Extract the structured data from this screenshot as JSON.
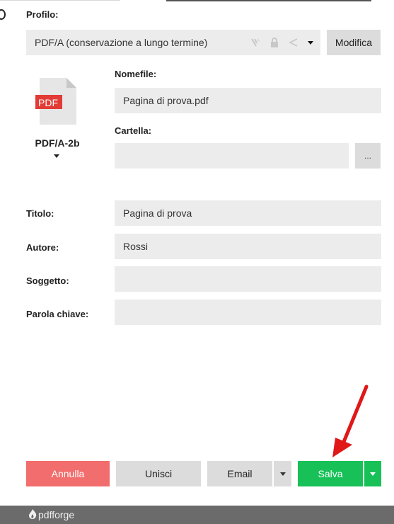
{
  "profile": {
    "label": "Profilo:",
    "value": "PDF/A (conservazione a lungo termine)",
    "edit_button": "Modifica",
    "icons": [
      "signature-icon",
      "lock-icon",
      "share-icon",
      "chevron-down-icon"
    ]
  },
  "document": {
    "icon_label": "PDF",
    "type_label": "PDF/A-2b",
    "filename_label": "Nomefile:",
    "filename_value": "Pagina di prova.pdf",
    "folder_label": "Cartella:",
    "folder_value": "",
    "browse_button": "..."
  },
  "metadata": {
    "title_label": "Titolo:",
    "title_value": "Pagina di prova",
    "author_label": "Autore:",
    "author_value": "Rossi",
    "subject_label": "Soggetto:",
    "subject_value": "",
    "keywords_label": "Parola chiave:",
    "keywords_value": ""
  },
  "actions": {
    "cancel": "Annulla",
    "merge": "Unisci",
    "email": "Email",
    "save": "Salva"
  },
  "footer": {
    "brand": "pdfforge"
  },
  "colors": {
    "field_bg": "#ececec",
    "button_bg": "#dcdcdc",
    "cancel": "#f26d6d",
    "save": "#17c158",
    "footer": "#6b6b6b",
    "annotation_arrow": "#e01818"
  }
}
